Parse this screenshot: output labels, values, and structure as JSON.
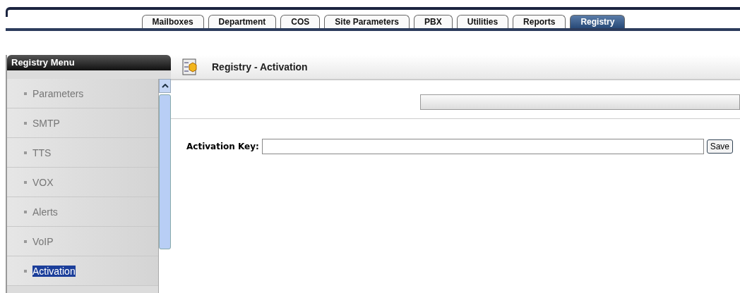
{
  "tabs": [
    {
      "label": "Mailboxes",
      "selected": false
    },
    {
      "label": "Department",
      "selected": false
    },
    {
      "label": "COS",
      "selected": false
    },
    {
      "label": "Site Parameters",
      "selected": false
    },
    {
      "label": "PBX",
      "selected": false
    },
    {
      "label": "Utilities",
      "selected": false
    },
    {
      "label": "Reports",
      "selected": false
    },
    {
      "label": "Registry",
      "selected": true
    }
  ],
  "sidebar": {
    "title": "Registry Menu",
    "items": [
      {
        "label": "Parameters",
        "selected": false
      },
      {
        "label": "SMTP",
        "selected": false
      },
      {
        "label": "TTS",
        "selected": false
      },
      {
        "label": "VOX",
        "selected": false
      },
      {
        "label": "Alerts",
        "selected": false
      },
      {
        "label": "VoIP",
        "selected": false
      },
      {
        "label": "Activation",
        "selected": true
      }
    ]
  },
  "content": {
    "title": "Registry - Activation",
    "field_label": "Activation Key:",
    "save_button": "Save"
  }
}
